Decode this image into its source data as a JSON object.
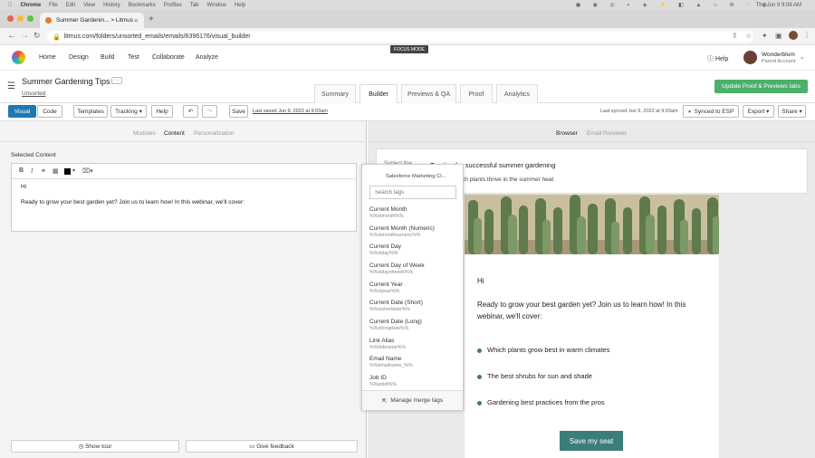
{
  "mac_menu": {
    "app": "Chrome",
    "items": [
      "File",
      "Edit",
      "View",
      "History",
      "Bookmarks",
      "Profiles",
      "Tab",
      "Window",
      "Help"
    ],
    "clock": "Thu Jun 9  9:08 AM"
  },
  "browser": {
    "tab_title": "Summer Gardenin... > Litmus",
    "url": "litmus.com/folders/unsorted_emails/emails/6396176/visual_builder",
    "focus_mode": "FOCUS MODE"
  },
  "nav": {
    "items": [
      "Home",
      "Design",
      "Build",
      "Test",
      "Collaborate",
      "Analyze"
    ],
    "help": "Help",
    "user_name": "Wonderblum",
    "user_role": "Parent Account"
  },
  "email": {
    "title": "Summer Gardening Tips",
    "folder": "Unsorted",
    "more": "···"
  },
  "page_tabs": [
    "Summary",
    "Builder",
    "Previews & QA",
    "Proof",
    "Analytics"
  ],
  "update_btn": "Update Proof & Previews tabs",
  "toolbar": {
    "visual": "Visual",
    "code": "Code",
    "templates": "Templates",
    "tracking": "Tracking",
    "help": "Help",
    "save": "Save",
    "last_saved": "Last saved Jun 9, 2022 at 9:03am",
    "synced_label": "Last synced Jun 9, 2022 at 9:03am",
    "synced_esp": "Synced to ESP",
    "export": "Export",
    "share": "Share"
  },
  "left": {
    "subtabs": [
      "Modules",
      "Content",
      "Personalization"
    ],
    "selected_label": "Selected Content",
    "format": {
      "bold": "B",
      "italic": "I"
    },
    "content_line1": "Hi",
    "content_line2": "Ready to grow your best garden yet? Join us  to learn how! In this webinar, we'll cover:",
    "show_tour": "Show tour",
    "give_feedback": "Give feedback"
  },
  "right": {
    "subtabs": [
      "Browser",
      "Email Previews"
    ],
    "subject_partial": "Subject line",
    "subject": "Top tips for successful summer gardening",
    "preheader": "Find out which plants thrive in the summer heat",
    "greeting": "Hi",
    "body": "Ready to grow your best garden yet? Join us  to learn how! In this webinar, we'll cover:",
    "bullets": [
      "Which plants grow best in warm climates",
      "The best shrubs for sun and shade",
      "Gardening best practices from the pros"
    ],
    "cta": "Save my seat"
  },
  "merge_dropdown": {
    "header": "Salesforce Marketing Cl...",
    "search_placeholder": "Search tags",
    "tags": [
      {
        "name": "Current Month",
        "code": "%%xtmonth%%"
      },
      {
        "name": "Current Month (Numeric)",
        "code": "%%xtmonthnumeric%%"
      },
      {
        "name": "Current Day",
        "code": "%%xtday%%"
      },
      {
        "name": "Current Day of Week",
        "code": "%%xtdayofweek%%"
      },
      {
        "name": "Current Year",
        "code": "%%xtyear%%"
      },
      {
        "name": "Current Date (Short)",
        "code": "%%xtshortdate%%"
      },
      {
        "name": "Current Date (Long)",
        "code": "%%xtlongdate%%"
      },
      {
        "name": "Link Alias",
        "code": "%%linkname%%"
      },
      {
        "name": "Email Name",
        "code": "%%emailname_%%"
      },
      {
        "name": "Job ID",
        "code": "%%jobid%%"
      }
    ],
    "manage": "Manage merge tags"
  },
  "colors": {
    "accent": "#1f78b4",
    "teal": "#3a7d7a",
    "green": "#4caf6a"
  }
}
